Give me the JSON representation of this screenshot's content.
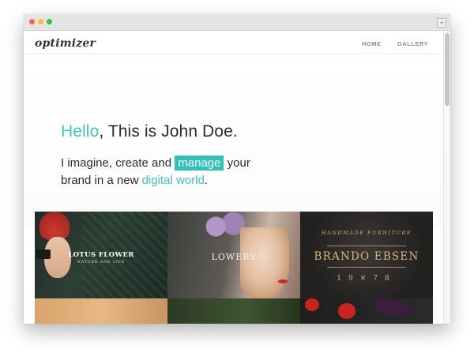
{
  "window": {
    "expand_glyph": "+"
  },
  "site": {
    "logo": "optimizer",
    "nav": [
      {
        "label": "HOME"
      },
      {
        "label": "GALLERY"
      }
    ]
  },
  "hero": {
    "hello_accent": "Hello",
    "hello_rest": ", This is John Doe.",
    "line1_prefix": "I imagine, create and ",
    "line1_highlight": "manage",
    "line1_suffix": " your",
    "line2_prefix": "brand in a new ",
    "line2_accent": "digital world",
    "line2_suffix": "."
  },
  "gallery": {
    "tiles": [
      {
        "title": "LOTUS FLOWER",
        "subtitle": "NATURE AND LIFE"
      },
      {
        "title": "LOWERY"
      },
      {
        "top": "HANDMADE FURNITURE",
        "name": "BRANDO EBSEN",
        "year_left": "19",
        "year_right": "78"
      }
    ]
  },
  "colors": {
    "accent": "#3cc8bc",
    "highlight_bg": "#2fc2b5",
    "text": "#2b2b2b"
  }
}
